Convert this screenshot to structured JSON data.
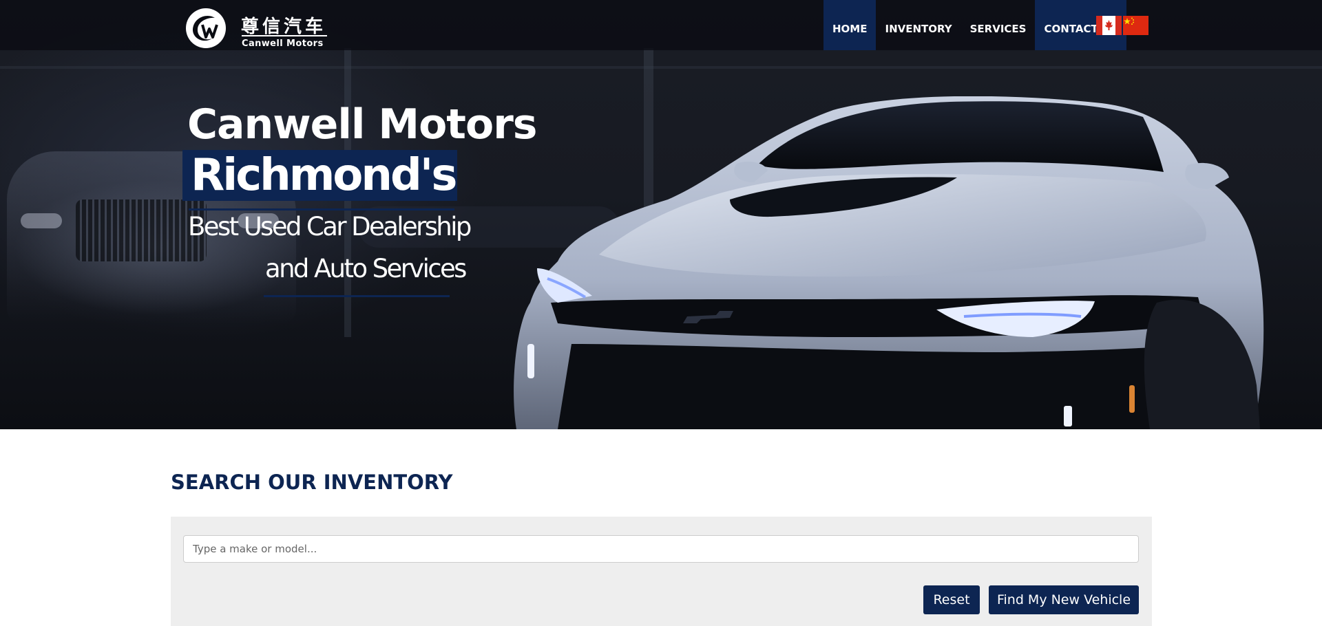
{
  "colors": {
    "brand_navy": "#0d2552",
    "panel_bg": "#eeeeee",
    "nav_bg": "#080a10"
  },
  "logo": {
    "chinese": "尊信汽车",
    "english": "Canwell Motors",
    "icon": "canwell-cw-logo"
  },
  "nav": {
    "items": [
      {
        "label": "HOME",
        "active": true
      },
      {
        "label": "INVENTORY",
        "active": false
      },
      {
        "label": "SERVICES",
        "active": false
      },
      {
        "label": "CONTACT US",
        "active": true
      }
    ],
    "flags": [
      "canada-flag-icon",
      "china-flag-icon"
    ]
  },
  "hero": {
    "line1": "Canwell Motors",
    "line2": "Richmond's",
    "line3": "Best Used Car Dealership",
    "line4": "and Auto Services"
  },
  "search": {
    "heading_bold": "SEARCH",
    "heading_rest": " OUR INVENTORY",
    "placeholder": "Type a make or model...",
    "value": "",
    "reset_label": "Reset",
    "find_label": "Find My New Vehicle"
  }
}
